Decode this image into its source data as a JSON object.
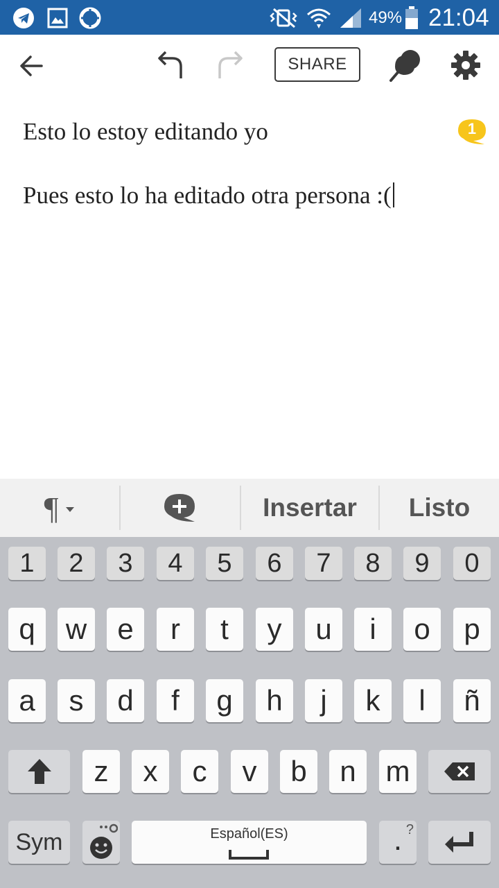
{
  "status_bar": {
    "battery_percent": "49%",
    "time": "21:04",
    "icons": [
      "telegram-icon",
      "gallery-icon",
      "lifebuoy-icon",
      "vibrate-off-icon",
      "wifi-icon",
      "signal-icon",
      "battery-icon"
    ]
  },
  "toolbar": {
    "share_label": "SHARE",
    "icons": [
      "back-arrow-icon",
      "undo-icon",
      "redo-icon",
      "pin-icon",
      "settings-icon"
    ]
  },
  "document": {
    "paragraphs": [
      "Esto lo estoy editando yo",
      "Pues esto lo ha editado otra persona :("
    ],
    "comment_count": "1",
    "comment_badge_color": "#f7c51b"
  },
  "format_bar": {
    "paragraph_symbol": "¶",
    "insert_label": "Insertar",
    "done_label": "Listo"
  },
  "keyboard": {
    "number_row": [
      "1",
      "2",
      "3",
      "4",
      "5",
      "6",
      "7",
      "8",
      "9",
      "0"
    ],
    "row1": [
      "q",
      "w",
      "e",
      "r",
      "t",
      "y",
      "u",
      "i",
      "o",
      "p"
    ],
    "row2": [
      "a",
      "s",
      "d",
      "f",
      "g",
      "h",
      "j",
      "k",
      "l",
      "ñ"
    ],
    "row3": [
      "z",
      "x",
      "c",
      "v",
      "b",
      "n",
      "m"
    ],
    "sym_label": "Sym",
    "space_label": "Español(ES)",
    "period_label": ".",
    "period_hint": "?"
  },
  "colors": {
    "status_bar": "#1f62a6",
    "keyboard_bg": "#bfc1c6",
    "format_bar_bg": "#f1f1f1"
  }
}
